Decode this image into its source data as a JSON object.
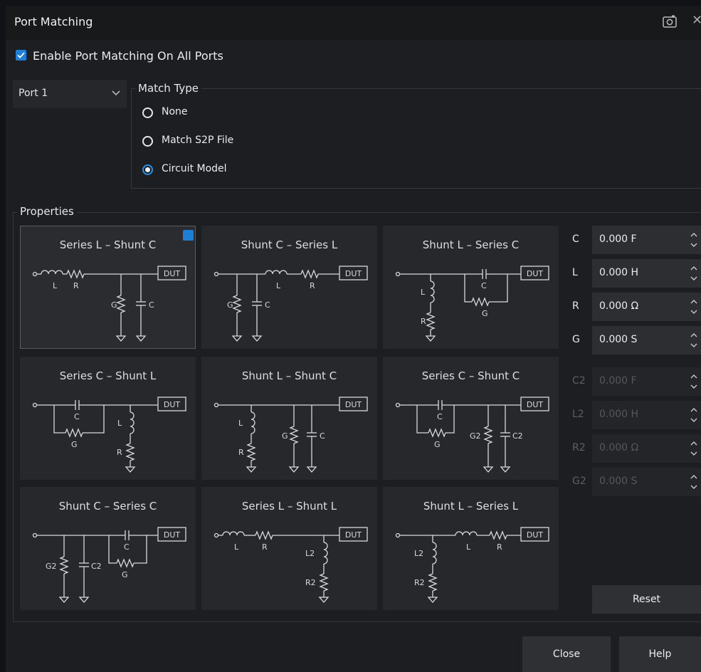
{
  "window": {
    "title": "Port Matching"
  },
  "enable": {
    "label": "Enable Port Matching On All Ports",
    "checked": true
  },
  "port_select": {
    "value": "Port 1"
  },
  "match_type": {
    "title": "Match Type",
    "options": [
      "None",
      "Match S2P File",
      "Circuit Model"
    ],
    "selected": "Circuit Model"
  },
  "properties": {
    "title": "Properties",
    "circuits": [
      {
        "title": "Series L – Shunt C",
        "selected": true
      },
      {
        "title": "Shunt C – Series L"
      },
      {
        "title": "Shunt L – Series C"
      },
      {
        "title": "Series C – Shunt L"
      },
      {
        "title": "Shunt L – Shunt C"
      },
      {
        "title": "Series C – Shunt C"
      },
      {
        "title": "Shunt C – Series C"
      },
      {
        "title": "Series L – Shunt L"
      },
      {
        "title": "Shunt L – Series L"
      }
    ],
    "params": [
      {
        "name": "C",
        "value": "0.000 F",
        "enabled": true
      },
      {
        "name": "L",
        "value": "0.000 H",
        "enabled": true
      },
      {
        "name": "R",
        "value": "0.000 Ω",
        "enabled": true
      },
      {
        "name": "G",
        "value": "0.000 S",
        "enabled": true
      },
      {
        "name": "C2",
        "value": "0.000 F",
        "enabled": false
      },
      {
        "name": "L2",
        "value": "0.000 H",
        "enabled": false
      },
      {
        "name": "R2",
        "value": "0.000 Ω",
        "enabled": false
      },
      {
        "name": "G2",
        "value": "0.000 S",
        "enabled": false
      }
    ],
    "reset_label": "Reset"
  },
  "schematic_labels": {
    "dut": "DUT",
    "l": "L",
    "r": "R",
    "g": "G",
    "c": "C",
    "l2": "L2",
    "r2": "R2",
    "g2": "G2",
    "c2": "C2"
  },
  "footer": {
    "close_label": "Close",
    "help_label": "Help"
  },
  "colors": {
    "accent": "#1f7fd6",
    "background": "#1d1e21",
    "tile": "#26282b",
    "wire": "#d9d9d9"
  },
  "icons": {
    "screenshot": "camera-icon",
    "close": "close-icon",
    "dropdown": "chevron-down-icon",
    "spinner": "spinner-arrows-icon",
    "check": "checkmark-icon"
  }
}
